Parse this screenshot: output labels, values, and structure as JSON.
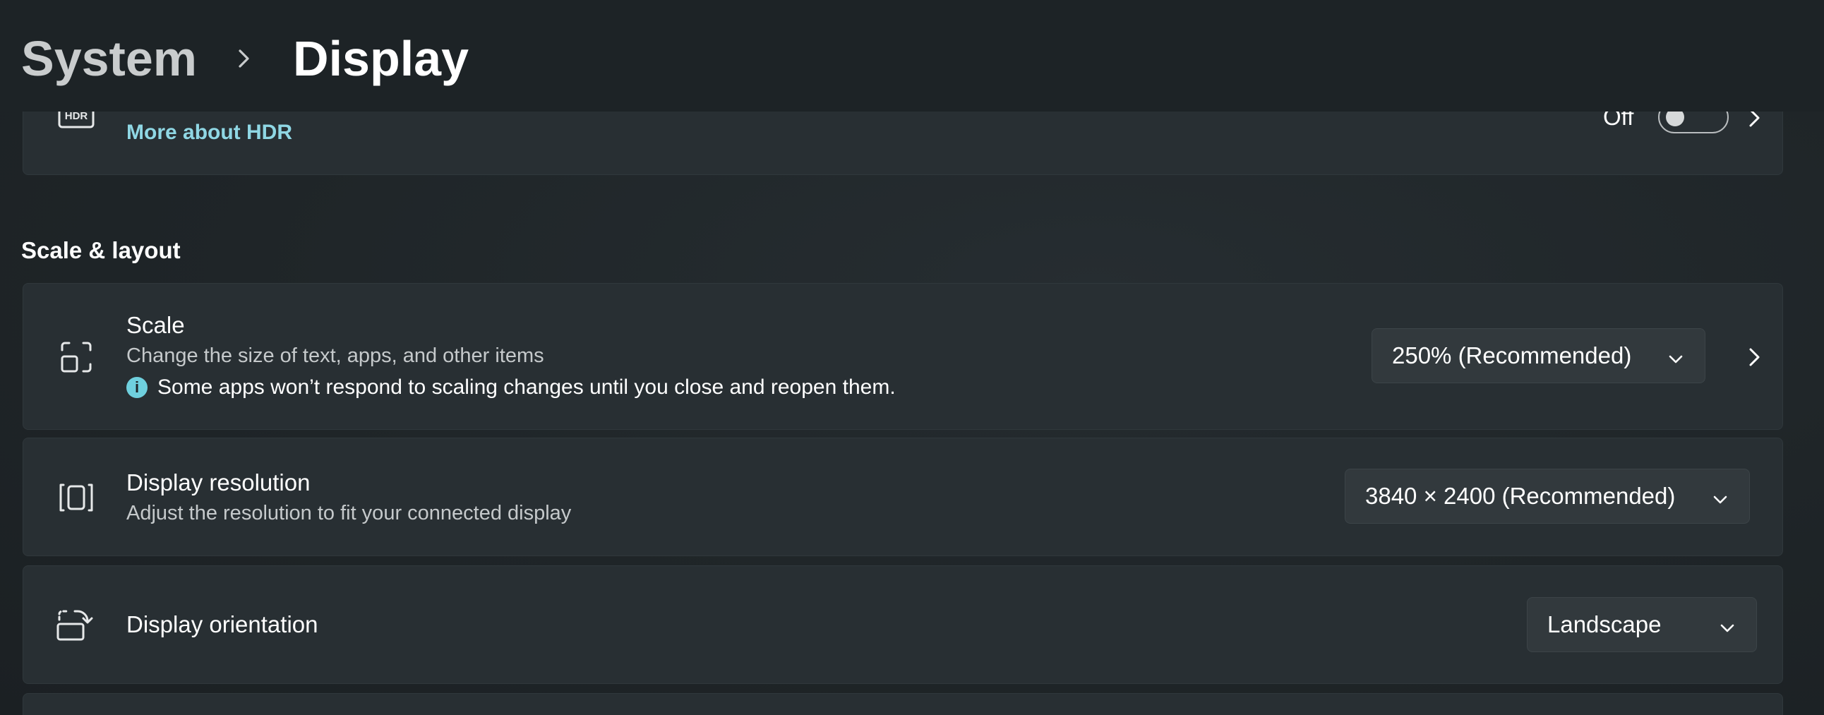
{
  "header": {
    "breadcrumb_parent": "System",
    "breadcrumb_current": "Display"
  },
  "hdr": {
    "link": "More about HDR",
    "toggle_label": "Off",
    "toggle_on": false
  },
  "section": {
    "heading": "Scale & layout"
  },
  "scale": {
    "title": "Scale",
    "subtitle": "Change the size of text, apps, and other items",
    "note": "Some apps won’t respond to scaling changes until you close and reopen them.",
    "info_glyph": "i",
    "value": "250% (Recommended)"
  },
  "resolution": {
    "title": "Display resolution",
    "subtitle": "Adjust the resolution to fit your connected display",
    "value": "3840 × 2400 (Recommended)"
  },
  "orientation": {
    "title": "Display orientation",
    "value": "Landscape"
  },
  "icons": {
    "hdr": "hdr-icon",
    "scale": "scale-icon",
    "resolution": "resolution-icon",
    "orientation": "orientation-icon",
    "chevron_right": "chevron-right-icon",
    "chevron_down": "chevron-down-icon",
    "info": "info-icon"
  },
  "colors": {
    "background": "#1e2427",
    "card": "#282f33",
    "link_accent": "#8fd7e4",
    "info_accent": "#6fd0de"
  }
}
